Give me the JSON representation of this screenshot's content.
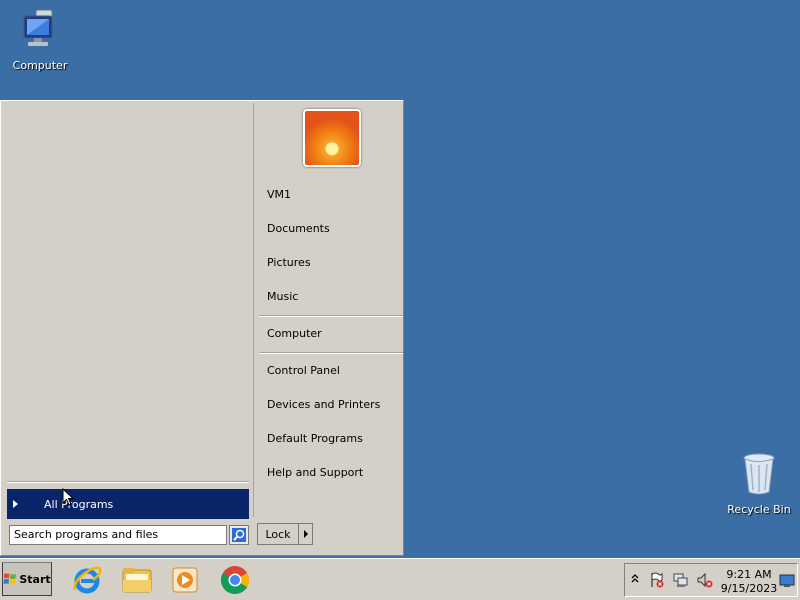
{
  "desktop": {
    "computer_label": "Computer",
    "recycle_bin_label": "Recycle Bin"
  },
  "start_menu": {
    "all_programs_label": "All Programs",
    "search_placeholder": "Search programs and files",
    "lock_label": "Lock",
    "right_items": [
      "VM1",
      "Documents",
      "Pictures",
      "Music",
      "Computer",
      "Control Panel",
      "Devices and Printers",
      "Default Programs",
      "Help and Support"
    ]
  },
  "taskbar": {
    "start_label": "Start",
    "pinned_apps": [
      "internet-explorer-icon",
      "windows-explorer-icon",
      "media-player-icon",
      "chrome-icon"
    ],
    "time": "9:21 AM",
    "date": "9/15/2023"
  },
  "colors": {
    "desktop": "#3a6ea5",
    "menu_bg": "#d4d0c8",
    "highlight": "#0a246a"
  }
}
